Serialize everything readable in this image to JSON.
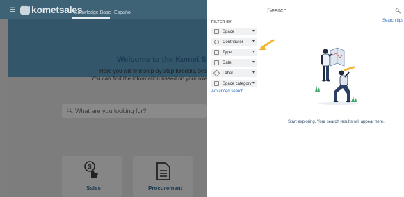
{
  "header": {
    "logo_text": "kometsales",
    "nav": [
      "Knowledge Base",
      "Español"
    ]
  },
  "hero": {
    "title": "Welcome to the Komet Sa",
    "line1": "Here you will find step-by-step tutorials, syster",
    "line2": "You can find the information based on your role be"
  },
  "background_search": {
    "placeholder": "What are you looking for?"
  },
  "cards": [
    "Sales",
    "Procurement"
  ],
  "panel": {
    "title": "Search",
    "search_tips": "Search tips",
    "filter_by": "FILTER BY",
    "filters": [
      "Space",
      "Contributor",
      "Type",
      "Date",
      "Label",
      "Space category"
    ],
    "advanced_search": "Advanced search",
    "empty_message": "Start exploring. Your search results will appear here."
  },
  "colors": {
    "header_bg": "#3e6276",
    "link": "#2d6bbf",
    "arrow": "#f1b530",
    "overlay_page": "#7e7e7e"
  }
}
